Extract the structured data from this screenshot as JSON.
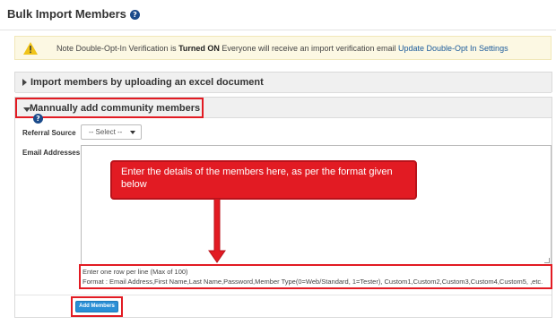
{
  "page": {
    "title": "Bulk Import Members"
  },
  "alert": {
    "prefix": "Note Double-Opt-In Verification is ",
    "status": "Turned ON",
    "middle": " Everyone will receive an import verification email ",
    "link": "Update Double-Opt In Settings"
  },
  "excel_panel": {
    "heading": "Import members by uploading an excel document"
  },
  "manual_panel": {
    "heading": "Mannually add community members",
    "referral_label": "Referral Source",
    "referral_selected": "-- Select --",
    "email_label": "Email Addresses",
    "email_value": "",
    "callout": "Enter the details of the members here, as per the format given below",
    "format_line1": "Enter one row per line (Max of 100)",
    "format_line2": "Format : Email Address,First Name,Last Name,Password,Member Type(0=Web/Standard, 1=Tester), Custom1,Custom2,Custom3,Custom4,Custom5, ,etc.",
    "add_button": "Add Members"
  },
  "colors": {
    "highlight": "#e21b23",
    "button": "#2a8fd6",
    "alert_bg": "#fcf8e3",
    "link": "#1a5a9a"
  },
  "icons": [
    "help-icon",
    "warning-icon",
    "caret-right-icon",
    "caret-down-icon",
    "chevron-down-icon"
  ]
}
